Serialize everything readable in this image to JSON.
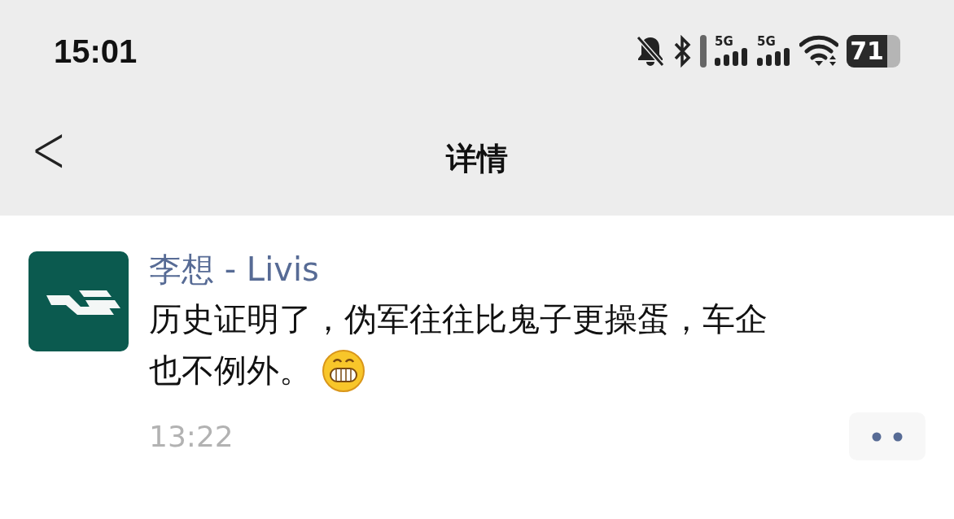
{
  "status_bar": {
    "time": "15:01",
    "network_labels": [
      "5G",
      "5G"
    ],
    "battery": "71"
  },
  "nav_bar": {
    "back": "<",
    "title": "详情"
  },
  "post": {
    "author": "李想 - Livis",
    "text_lines": [
      "历史证明了，伪军往往比鬼子更操蛋，车企",
      "也不例外。"
    ],
    "time": "13:22"
  }
}
